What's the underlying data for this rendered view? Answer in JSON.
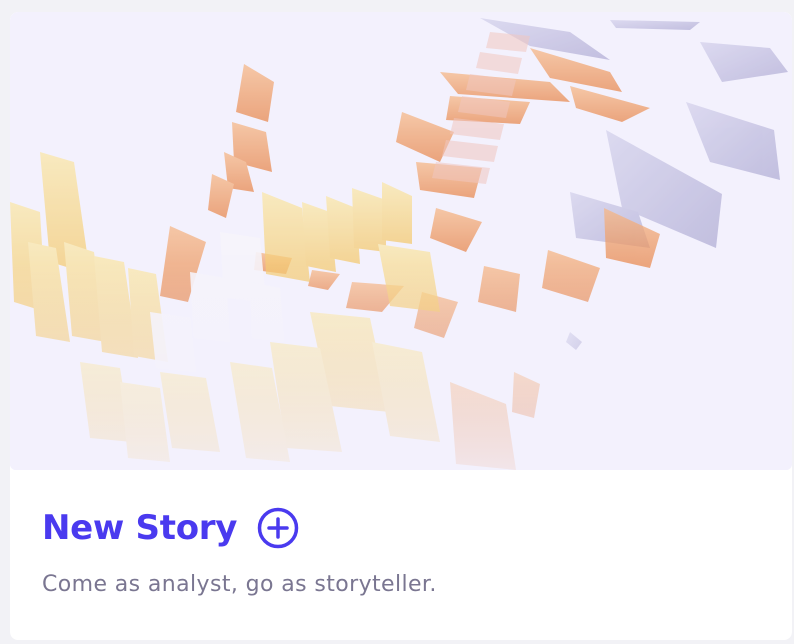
{
  "card": {
    "title": "New Story",
    "subtitle": "Come as analyst, go as storyteller.",
    "action_icon": "plus-circle-icon",
    "hero_image": "abstract-3d-shards-illustration"
  },
  "colors": {
    "accent": "#4a3aef",
    "subtitle": "#7a7691",
    "hero_background": "#f3f1fd",
    "page_background": "#f2f2f6"
  }
}
